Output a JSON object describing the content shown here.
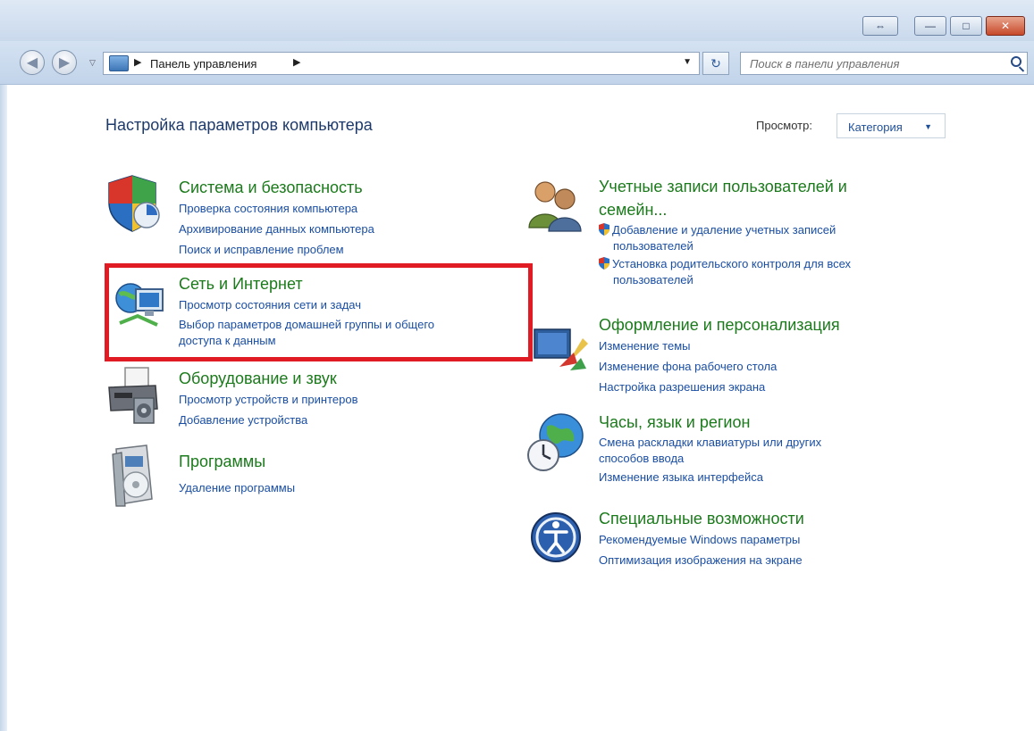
{
  "window": {
    "caption_buttons": [
      "⇔",
      "—",
      "□",
      "✕"
    ]
  },
  "nav": {
    "back_icon": "arrow-left-icon",
    "forward_icon": "arrow-right-icon",
    "breadcrumb": "Панель управления",
    "search_placeholder": "Поиск в панели управления"
  },
  "header": {
    "title": "Настройка параметров компьютера",
    "view_label": "Просмотр:",
    "view_value": "Категория"
  },
  "categories_left": [
    {
      "title": "Система и безопасность",
      "icon": "shield-icon",
      "links": [
        "Проверка состояния компьютера",
        "Архивирование данных компьютера",
        "Поиск и исправление проблем"
      ]
    },
    {
      "title": "Сеть и Интернет",
      "icon": "network-icon",
      "links": [
        "Просмотр состояния сети и задач",
        "Выбор параметров домашней группы и общего",
        "доступа к данным"
      ]
    },
    {
      "title": "Оборудование и звук",
      "icon": "printer-icon",
      "links": [
        "Просмотр устройств и принтеров",
        "Добавление устройства"
      ]
    },
    {
      "title": "Программы",
      "icon": "programs-icon",
      "links": [
        "Удаление программы"
      ]
    }
  ],
  "categories_right": [
    {
      "title_line1": "Учетные записи пользователей и",
      "title_line2": "семейн...",
      "icon": "users-icon",
      "links": [
        "Добавление и удаление учетных записей",
        "пользователей",
        "Установка родительского контроля для всех",
        "пользователей"
      ]
    },
    {
      "title": "Оформление и персонализация",
      "icon": "appearance-icon",
      "links": [
        "Изменение темы",
        "Изменение фона рабочего стола",
        "Настройка разрешения экрана"
      ]
    },
    {
      "title": "Часы, язык и регион",
      "icon": "globe-clock-icon",
      "links": [
        "Смена раскладки клавиатуры или других",
        "способов ввода",
        "Изменение языка интерфейса"
      ]
    },
    {
      "title": "Специальные возможности",
      "icon": "accessibility-icon",
      "links": [
        "Рекомендуемые Windows параметры",
        "Оптимизация изображения на экране"
      ]
    }
  ],
  "colors": {
    "category_title": "#1b7a1b",
    "link": "#1a4ea3",
    "highlight": "#e01b24"
  }
}
